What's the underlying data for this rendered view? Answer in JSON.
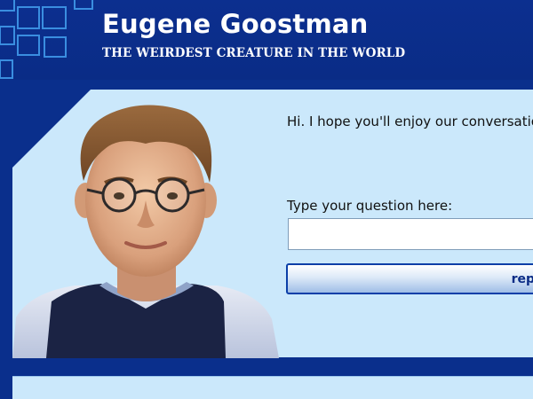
{
  "header": {
    "title": "Eugene Goostman",
    "subtitle": "THE WEIRDEST CREATURE IN THE WORLD"
  },
  "chat": {
    "greeting": "Hi. I hope you'll enjoy our conversation!",
    "question_label": "Type your question here:",
    "question_value": "",
    "reply_button_label": "reply"
  },
  "avatar": {
    "icon": "eugene-goostman-avatar"
  },
  "colors": {
    "header_bg": "#0a2f8c",
    "panel_bg": "#cbe8fb",
    "title_text": "#ffffff",
    "button_border": "#0b3fa8"
  }
}
